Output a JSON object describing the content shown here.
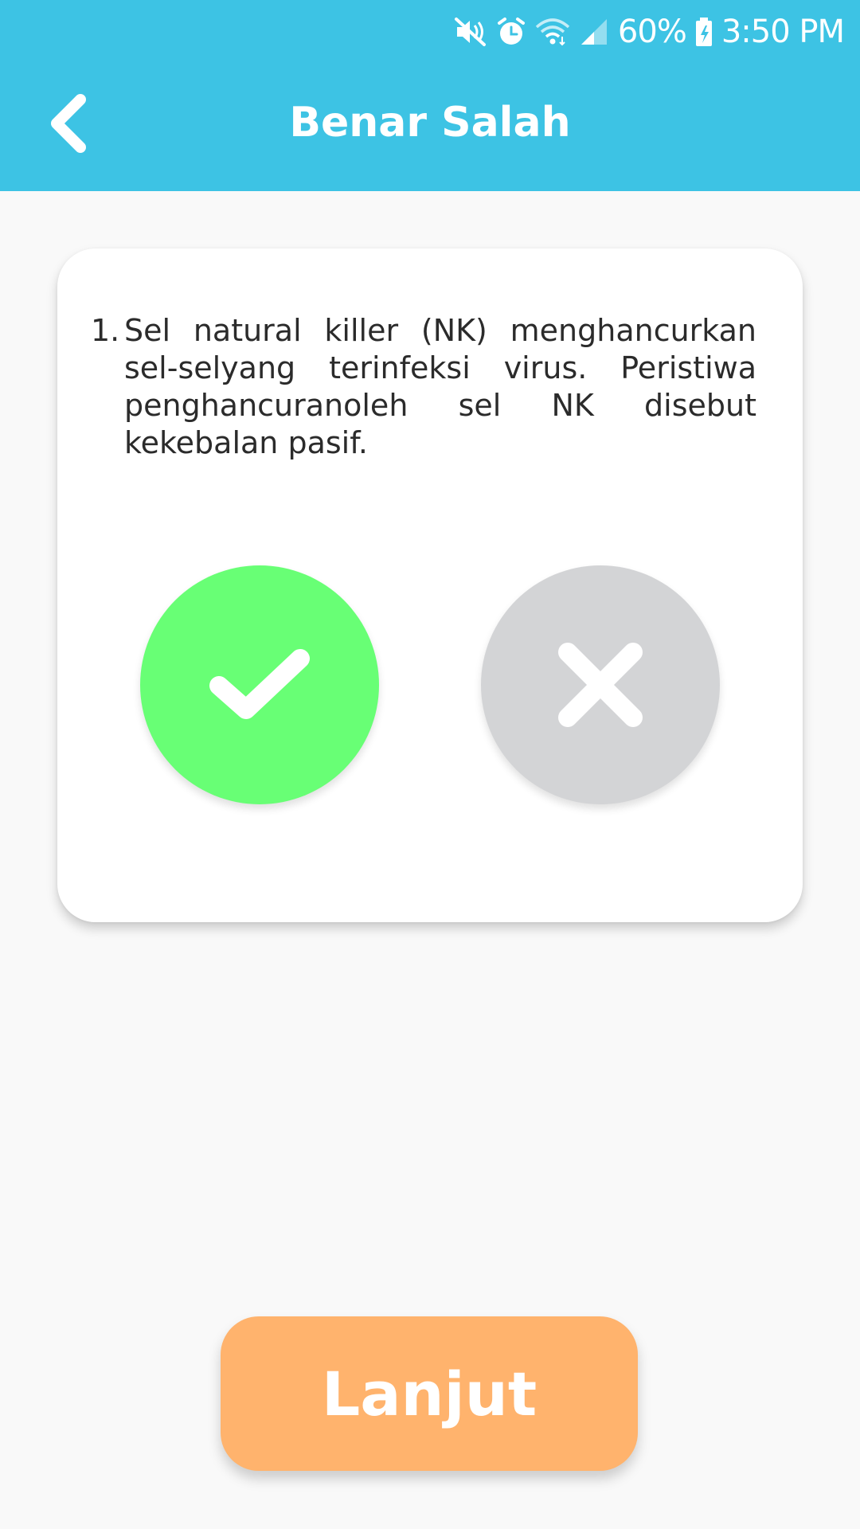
{
  "status_bar": {
    "battery": "60%",
    "time": "3:50 PM",
    "icons": [
      "mute-icon",
      "alarm-icon",
      "wifi-icon",
      "signal-icon",
      "battery-charging-icon"
    ]
  },
  "header": {
    "title": "Benar Salah",
    "back_icon": "chevron-left-icon",
    "background_color": "#3dc3e4"
  },
  "question": {
    "number": "1.",
    "text": "Sel natural killer (NK) menghancurkan sel-selyang terinfeksi virus. Peristiwa penghancuranoleh sel NK disebut kekebalan pasif."
  },
  "answers": {
    "true_icon": "check-icon",
    "true_color": "#68ff75",
    "false_icon": "close-icon",
    "false_color": "#d3d4d6"
  },
  "footer": {
    "next_label": "Lanjut",
    "next_color": "#ffb36d"
  }
}
